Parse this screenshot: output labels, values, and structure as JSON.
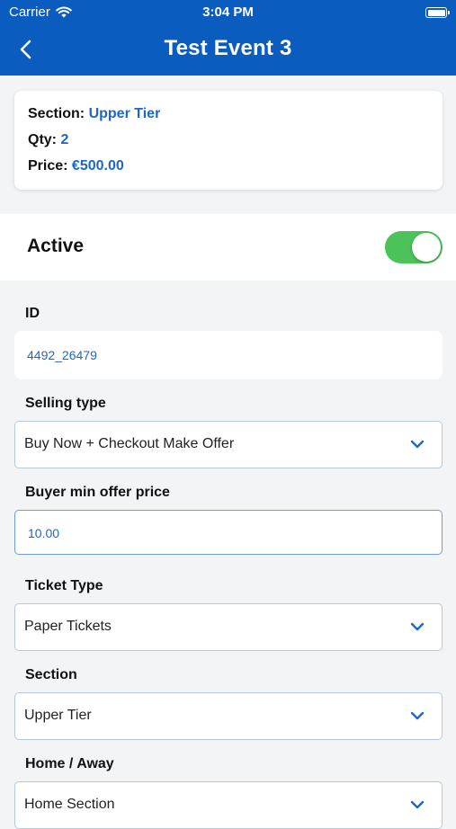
{
  "status_bar": {
    "carrier": "Carrier",
    "time": "3:04 PM"
  },
  "header": {
    "title": "Test Event 3"
  },
  "summary": {
    "section_label": "Section:",
    "section_value": "Upper Tier",
    "qty_label": "Qty:",
    "qty_value": "2",
    "price_label": "Price:",
    "price_value": "€500.00"
  },
  "active": {
    "label": "Active",
    "on": true
  },
  "id_field": {
    "label": "ID",
    "value": "4492_26479"
  },
  "selling_type": {
    "label": "Selling type",
    "value": "Buy Now + Checkout Make Offer"
  },
  "buyer_min_offer": {
    "label": "Buyer min offer price",
    "value": "10.00"
  },
  "ticket_type": {
    "label": "Ticket Type",
    "value": "Paper Tickets"
  },
  "section": {
    "label": "Section",
    "value": "Upper Tier"
  },
  "home_away": {
    "label": "Home / Away",
    "value": "Home Section"
  },
  "colors": {
    "primary": "#0b5cbf",
    "accent": "#1f66c6",
    "toggle_on": "#4cc35a"
  }
}
